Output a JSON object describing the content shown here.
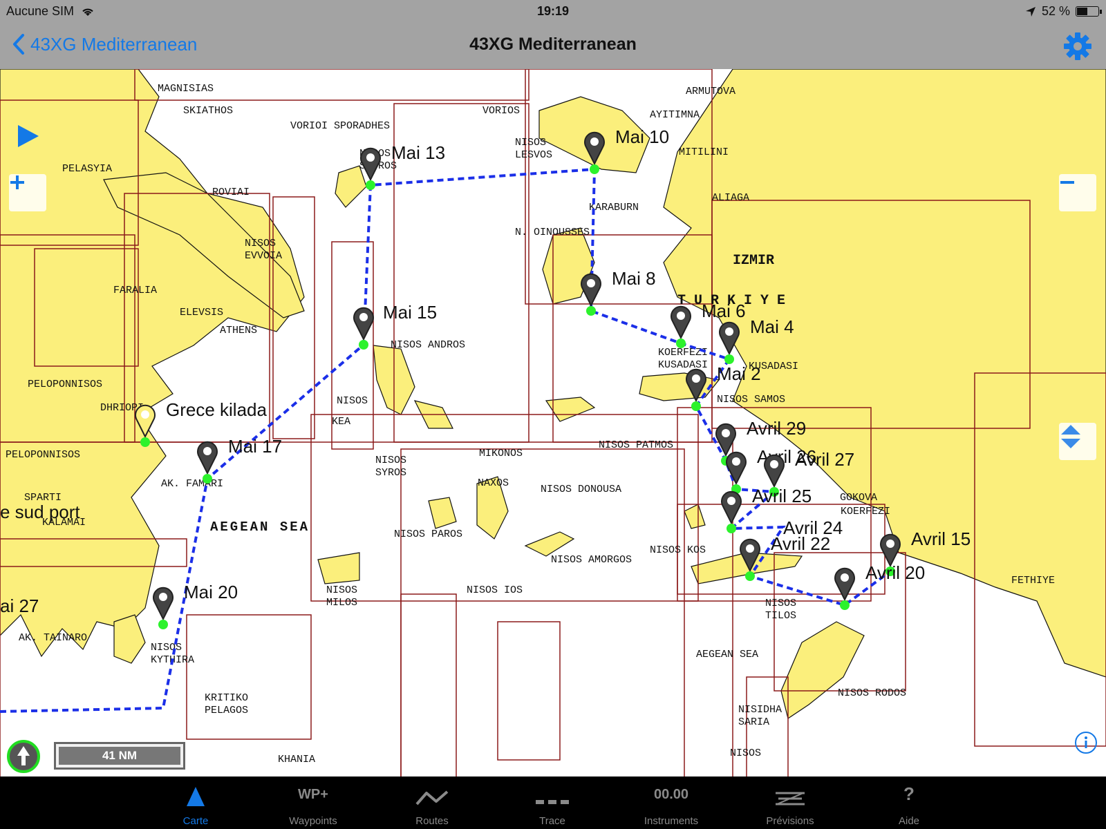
{
  "status": {
    "carrier": "Aucune SIM",
    "time": "19:19",
    "battery": "52 %",
    "battery_level": 0.52
  },
  "nav": {
    "back_label": "43XG Mediterranean",
    "title": "43XG Mediterranean"
  },
  "map": {
    "labels": [
      "MAGNISIAS",
      "SKIATHOS",
      "VORIOI SPORADHES",
      "VORIOS",
      "ARMUTOVA",
      "AYITIMNA",
      "PELASYIA",
      "NISOS SKYROS",
      "NISOS LESVOS",
      "MITILINI",
      "ROVIAI",
      "ALIAGA",
      "KARABURN",
      "N. OINOUSSES",
      "NISOS EVVOIA",
      "IZMIR",
      "FARALIA",
      "TURKIYE",
      "ELEVSIS",
      "ATHENS",
      "NISOS ANDROS",
      "KOERFEZI KUSADASI",
      "KUSADASI",
      "PELOPONNISOS",
      "NISOS",
      "NISOS SAMOS",
      "DHRIOPI",
      "KEA",
      "PELOPONNISOS",
      "NISOS PATMOS",
      "MIKONOS",
      "NISOS SYROS",
      "AK. FAMARI",
      "NAXOS",
      "NISOS DONOUSA",
      "SPARTI",
      "GOKOVA",
      "KALAMAI",
      "AEGEAN SEA",
      "KOERFEZI",
      "NISOS PAROS",
      "NISOS KOS",
      "NISOS AMORGOS",
      "NISOS MILOS",
      "NISOS IOS",
      "FETHIYE",
      "NISOS TILOS",
      "AK. TAINARO",
      "NISOS KYTHIRA",
      "AEGEAN SEA",
      "NISOS RODOS",
      "KRITIKO PELAGOS",
      "NISIDHA SARIA",
      "NISOS",
      "KHANIA"
    ],
    "waypoints": [
      "Mai 13",
      "Mai 10",
      "Mai 8",
      "Mai 6",
      "Mai 4",
      "Mai 2",
      "Mai 15",
      "Grece kilada",
      "Mai 17",
      "Avril 29",
      "Avril 26",
      "Avril 27",
      "Avril 25",
      "Avril 24",
      "Avril 22",
      "Avril 15",
      "Avril 20",
      "Mai 20",
      "e sud port",
      "ai 27"
    ],
    "scale": "41 NM"
  },
  "controls": {
    "play_icon": "play-icon",
    "zoom_in_icon": "plus-icon",
    "zoom_out_icon": "minus-icon",
    "layers_icon": "arrows-updown-icon",
    "north_icon": "north-arrow-icon",
    "info_icon": "info-icon"
  },
  "colors": {
    "land": "#fbef7c",
    "chart_border": "#8b1a1a",
    "route": "#1b2fe8",
    "waypoint_dot": "#2cf22c",
    "accent": "#1479e6"
  },
  "tabs": [
    {
      "label": "Carte",
      "icon": "map-triangle-icon",
      "active": true
    },
    {
      "label": "Waypoints",
      "icon": "wp-plus-icon",
      "glyph": "WP+",
      "active": false
    },
    {
      "label": "Routes",
      "icon": "route-zigzag-icon",
      "active": false
    },
    {
      "label": "Trace",
      "icon": "trace-dashes-icon",
      "active": false
    },
    {
      "label": "Instruments",
      "icon": "instruments-icon",
      "glyph": "00.00",
      "active": false
    },
    {
      "label": "Prévisions",
      "icon": "forecast-icon",
      "active": false
    },
    {
      "label": "Aide",
      "icon": "help-icon",
      "glyph": "?",
      "active": false
    }
  ]
}
